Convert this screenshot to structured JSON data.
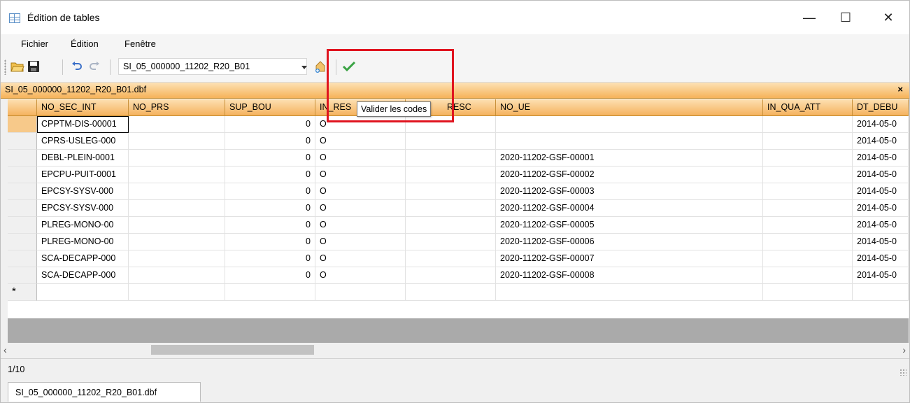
{
  "window": {
    "title": "Édition de tables",
    "controls": {
      "minimize": "—",
      "maximize": "☐",
      "close": "✕"
    }
  },
  "menu": [
    "Fichier",
    "Édition",
    "Fenêtre"
  ],
  "toolbar": {
    "table_select": "SI_05_000000_11202_R20_B01",
    "icons": [
      "open-folder-icon",
      "save-icon",
      "undo-icon",
      "redo-icon",
      "add-table-icon",
      "validate-codes-icon"
    ],
    "validate_tooltip": "Valider les codes"
  },
  "document": {
    "title": "SI_05_000000_11202_R20_B01.dbf",
    "close": "×"
  },
  "grid": {
    "columns": [
      "NO_SEC_INT",
      "NO_PRS",
      "SUP_BOU",
      "IN_RES",
      "RESC",
      "NO_UE",
      "IN_QUA_ATT",
      "DT_DEBU"
    ],
    "rows": [
      [
        "CPPTM-DIS-00001",
        "",
        "0",
        "O",
        "",
        "",
        "",
        "2014-05-0"
      ],
      [
        "CPRS-USLEG-000",
        "",
        "0",
        "O",
        "",
        "",
        "",
        "2014-05-0"
      ],
      [
        "DEBL-PLEIN-0001",
        "",
        "0",
        "O",
        "",
        "2020-11202-GSF-00001",
        "",
        "2014-05-0"
      ],
      [
        "EPCPU-PUIT-0001",
        "",
        "0",
        "O",
        "",
        "2020-11202-GSF-00002",
        "",
        "2014-05-0"
      ],
      [
        "EPCSY-SYSV-000",
        "",
        "0",
        "O",
        "",
        "2020-11202-GSF-00003",
        "",
        "2014-05-0"
      ],
      [
        "EPCSY-SYSV-000",
        "",
        "0",
        "O",
        "",
        "2020-11202-GSF-00004",
        "",
        "2014-05-0"
      ],
      [
        "PLREG-MONO-00",
        "",
        "0",
        "O",
        "",
        "2020-11202-GSF-00005",
        "",
        "2014-05-0"
      ],
      [
        "PLREG-MONO-00",
        "",
        "0",
        "O",
        "",
        "2020-11202-GSF-00006",
        "",
        "2014-05-0"
      ],
      [
        "SCA-DECAPP-000",
        "",
        "0",
        "O",
        "",
        "2020-11202-GSF-00007",
        "",
        "2014-05-0"
      ],
      [
        "SCA-DECAPP-000",
        "",
        "0",
        "O",
        "",
        "2020-11202-GSF-00008",
        "",
        "2014-05-0"
      ]
    ],
    "new_row_marker": "*"
  },
  "status": {
    "record": "1/10"
  },
  "bottom_tab": "SI_05_000000_11202_R20_B01.dbf",
  "scroll": {
    "left": "‹",
    "right": "›"
  }
}
